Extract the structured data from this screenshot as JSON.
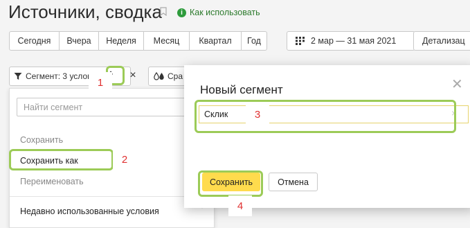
{
  "header": {
    "title": "Источники, сводка",
    "help_link": "Как использовать"
  },
  "periods": [
    "Сегодня",
    "Вчера",
    "Неделя",
    "Месяц",
    "Квартал",
    "Год"
  ],
  "date_range": "2 мар — 31 мая 2021",
  "detail_label": "Детализац",
  "segment": {
    "label": "Сегмент: 3 услови",
    "compare_label": "Сра"
  },
  "dropdown": {
    "search_placeholder": "Найти сегмент",
    "save": "Сохранить",
    "save_as": "Сохранить как",
    "rename": "Переименовать",
    "recent": "Недавно использованные условия"
  },
  "modal": {
    "title": "Новый сегмент",
    "input_value": "Склик",
    "save_button": "Сохранить",
    "cancel_button": "Отмена"
  },
  "annotations": [
    "1",
    "2",
    "3",
    "4"
  ],
  "colors": {
    "accent_yellow": "#ffdb4d",
    "highlight_green": "#9ccb57",
    "annotation_red": "#e03131",
    "link_green": "#2c7a2c"
  }
}
